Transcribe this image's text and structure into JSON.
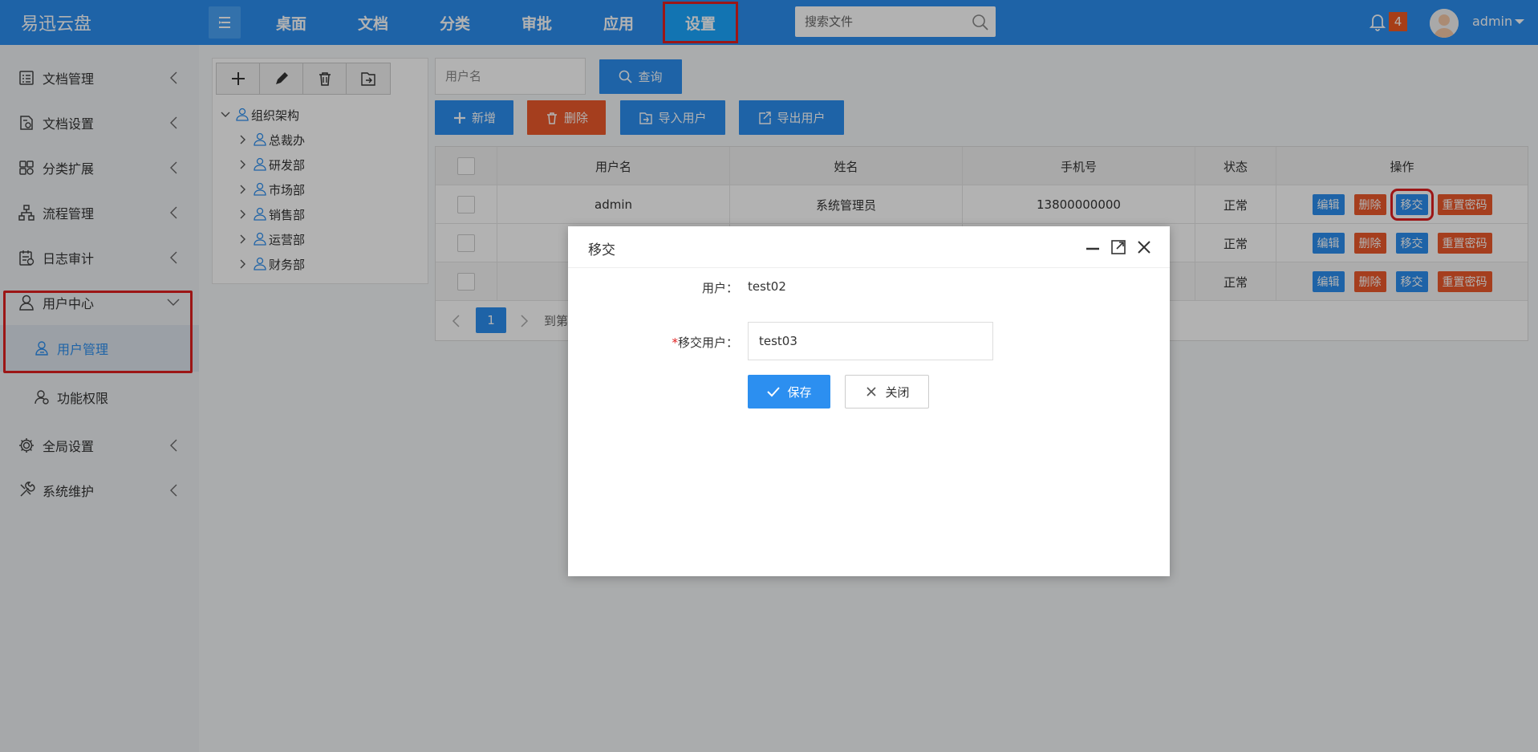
{
  "app": {
    "brand": "易迅云盘"
  },
  "topnav": {
    "items": [
      {
        "label": "桌面"
      },
      {
        "label": "文档"
      },
      {
        "label": "分类"
      },
      {
        "label": "审批"
      },
      {
        "label": "应用"
      },
      {
        "label": "设置",
        "active": true
      }
    ],
    "search_placeholder": "搜索文件",
    "notification_count": "4",
    "username": "admin"
  },
  "sidebar": {
    "items": [
      {
        "label": "文档管理",
        "icon": "document-list-icon"
      },
      {
        "label": "文档设置",
        "icon": "document-settings-icon"
      },
      {
        "label": "分类扩展",
        "icon": "category-grid-icon"
      },
      {
        "label": "流程管理",
        "icon": "workflow-icon"
      },
      {
        "label": "日志审计",
        "icon": "log-audit-icon"
      },
      {
        "label": "用户中心",
        "icon": "user-icon",
        "expanded": true
      },
      {
        "label": "全局设置",
        "icon": "gear-icon"
      },
      {
        "label": "系统维护",
        "icon": "tools-icon"
      }
    ],
    "sub_items": [
      {
        "label": "用户管理",
        "active": true
      },
      {
        "label": "功能权限"
      }
    ]
  },
  "tree": {
    "root": "组织架构",
    "children": [
      "总裁办",
      "研发部",
      "市场部",
      "销售部",
      "运营部",
      "财务部"
    ]
  },
  "toolbar": {
    "username_placeholder": "用户名",
    "query_label": "查询",
    "add_label": "新增",
    "delete_label": "删除",
    "import_label": "导入用户",
    "export_label": "导出用户"
  },
  "table": {
    "headers": [
      "用户名",
      "姓名",
      "手机号",
      "状态",
      "操作"
    ],
    "rows": [
      {
        "username": "admin",
        "name": "系统管理员",
        "phone": "13800000000",
        "status": "正常"
      },
      {
        "username": "",
        "name": "",
        "phone": "",
        "status": "正常"
      },
      {
        "username": "",
        "name": "",
        "phone": "",
        "status": "正常"
      }
    ],
    "actions": {
      "edit": "编辑",
      "delete": "删除",
      "transfer": "移交",
      "reset": "重置密码"
    },
    "pager": {
      "page": "1",
      "goto_text": "到第"
    }
  },
  "modal": {
    "title": "移交",
    "user_label": "用户：",
    "user_value": "test02",
    "required_mark": "*",
    "transfer_label": "移交用户：",
    "transfer_value": "test03",
    "save_label": "保存",
    "close_label": "关闭"
  },
  "colors": {
    "primary": "#2c8ff0",
    "danger": "#ec5a2b",
    "highlight": "#e02020"
  }
}
